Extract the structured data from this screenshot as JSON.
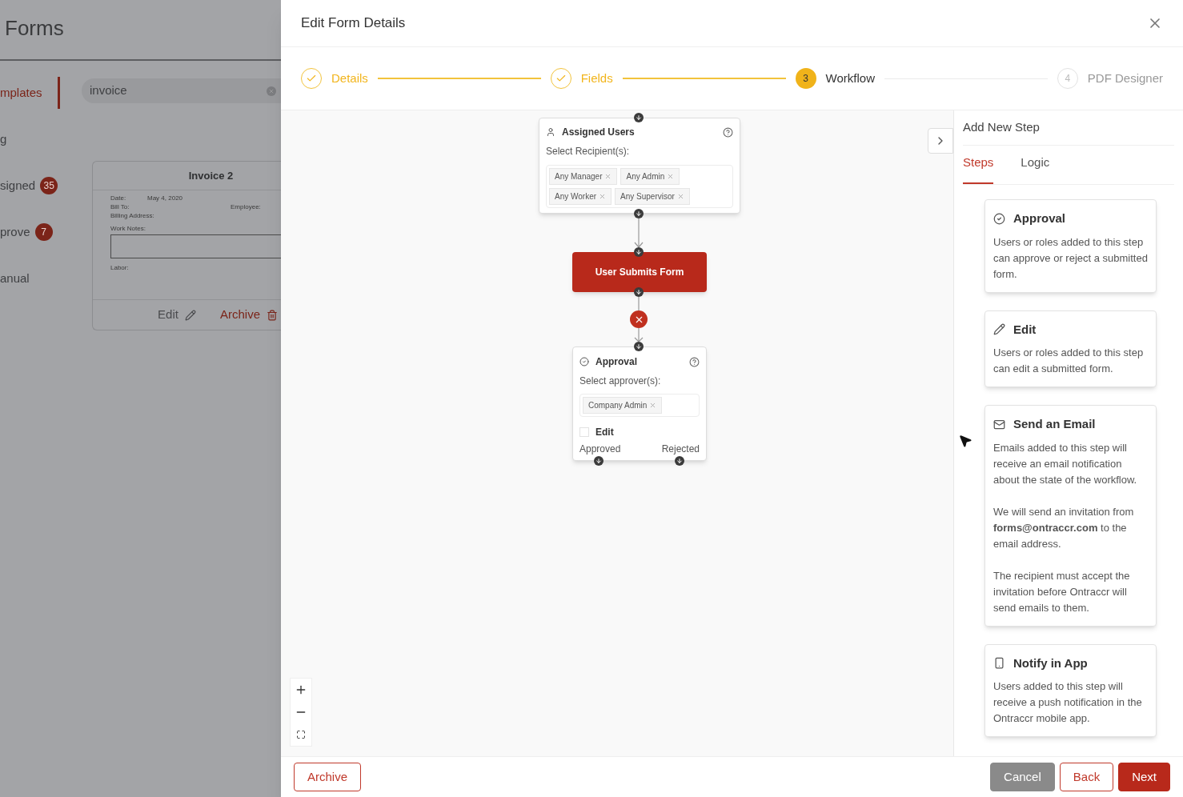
{
  "background_page": {
    "title": "Forms",
    "search": {
      "value": "invoice"
    },
    "nav_items": [
      {
        "label": "mplates",
        "selected": true
      },
      {
        "label": "g",
        "selected": false
      },
      {
        "label": "signed",
        "selected": false,
        "badge": "35"
      },
      {
        "label": "prove",
        "selected": false,
        "badge": "7"
      },
      {
        "label": "anual",
        "selected": false
      }
    ],
    "form_card": {
      "title": "Invoice 2",
      "preview": {
        "date_label": "Date:",
        "date": "May 4, 2020",
        "bill_to": "Bill To:",
        "employee": "Employee:",
        "billing_address": "Billing Address:",
        "work_notes": "Work Notes:",
        "labor": "Labor:"
      },
      "actions": [
        {
          "label": "Edit",
          "kind": "edit"
        },
        {
          "label": "Archive",
          "kind": "archive"
        }
      ]
    }
  },
  "dialog": {
    "title": "Edit Form Details",
    "steps": [
      {
        "label": "Details",
        "completed": true,
        "selected": false
      },
      {
        "label": "Fields",
        "completed": true,
        "selected": false
      },
      {
        "marker": "3",
        "label": "Workflow",
        "completed": false,
        "selected": true
      },
      {
        "marker": "4",
        "label": "PDF Designer",
        "completed": false,
        "selected": false
      }
    ],
    "workflow": {
      "nodes": [
        {
          "kind": "assigned",
          "title": "Assigned Users",
          "prompt": "Select Recipient(s):",
          "tags": [
            "Any Manager",
            "Any Admin",
            "Any Worker",
            "Any Supervisor"
          ]
        },
        {
          "kind": "trigger",
          "title": "User Submits Form"
        },
        {
          "kind": "approval",
          "title": "Approval",
          "prompt": "Select approver(s):",
          "tags": [
            "Company Admin"
          ],
          "edit": {
            "label": "Edit",
            "checked": false
          },
          "outputs": [
            "Approved",
            "Rejected"
          ]
        }
      ]
    },
    "side_panel": {
      "title": "Add New Step",
      "tabs": [
        {
          "label": "Steps",
          "selected": true
        },
        {
          "label": "Logic",
          "selected": false
        }
      ],
      "cards": [
        {
          "kind": "approval",
          "title": "Approval",
          "paragraphs": [
            "Users or roles added to this step can approve or reject a submitted form."
          ]
        },
        {
          "kind": "edit",
          "title": "Edit",
          "paragraphs": [
            "Users or roles added to this step can edit a submitted form."
          ]
        },
        {
          "kind": "email",
          "title": "Send an Email",
          "paragraphs": [
            "Emails added to this step will receive an email notification about the state of the workflow.",
            "We will send an invitation from **forms@ontraccr.com** to the email address.",
            "The recipient must accept the invitation before Ontraccr will send emails to them."
          ]
        },
        {
          "kind": "app",
          "title": "Notify in App",
          "paragraphs": [
            "Users added to this step will receive a push notification in the Ontraccr mobile app."
          ]
        }
      ]
    },
    "footer": {
      "left": [
        {
          "label": "Archive",
          "kind": "outline"
        }
      ],
      "right": [
        {
          "label": "Cancel",
          "kind": "muted"
        },
        {
          "label": "Back",
          "kind": "outline"
        },
        {
          "label": "Next",
          "kind": "primary"
        }
      ]
    }
  }
}
